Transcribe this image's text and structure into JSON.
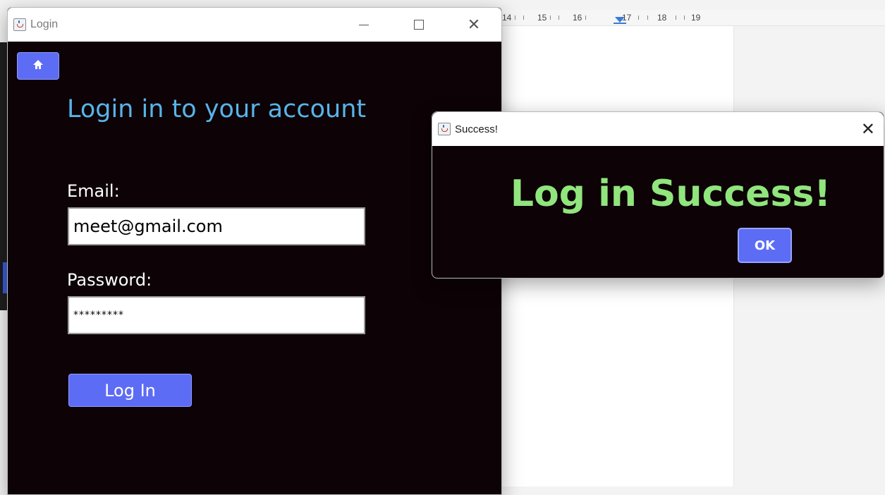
{
  "background": {
    "ruler_ticks": [
      "14",
      "15",
      "16",
      "17",
      "18",
      "19"
    ]
  },
  "login_window": {
    "title": "Login",
    "heading": "Login in to your account",
    "email_label": "Email:",
    "email_value": "meet@gmail.com",
    "password_label": "Password:",
    "password_value": "*********",
    "login_button": "Log In",
    "colors": {
      "background": "#0d0206",
      "heading": "#58b4e8",
      "button": "#5d6cf5"
    },
    "icons": [
      "java-icon",
      "home-icon",
      "minimize-icon",
      "maximize-icon",
      "close-icon"
    ]
  },
  "success_dialog": {
    "title": "Success!",
    "message": "Log in Success!",
    "ok_button": "OK",
    "colors": {
      "message": "#90e57d",
      "button": "#5d6cf5"
    },
    "icons": [
      "java-icon",
      "close-icon"
    ]
  }
}
